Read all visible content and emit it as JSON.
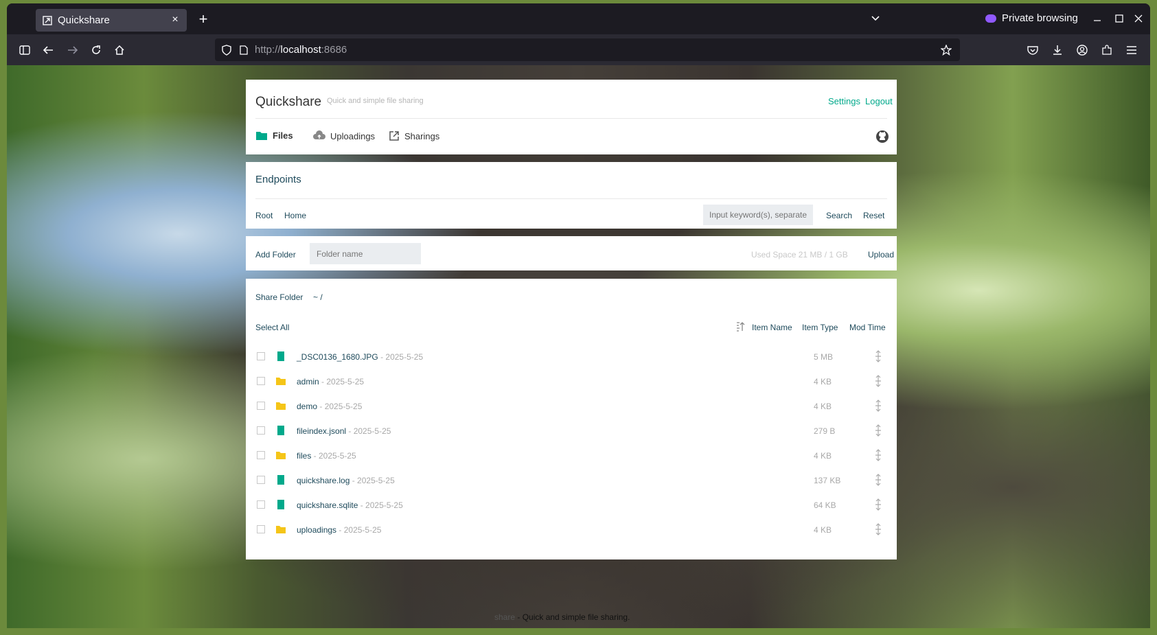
{
  "browser": {
    "tab_title": "Quickshare",
    "close_tab": "×",
    "new_tab": "+",
    "private_label": "Private browsing",
    "url_scheme": "http://",
    "url_host": "localhost",
    "url_port": ":8686"
  },
  "app": {
    "title": "Quickshare",
    "subtitle": "Quick and simple file sharing",
    "settings": "Settings",
    "logout": "Logout",
    "nav": {
      "files": "Files",
      "uploadings": "Uploadings",
      "sharings": "Sharings"
    }
  },
  "endpoints": {
    "title": "Endpoints",
    "root": "Root",
    "home": "Home",
    "search_placeholder": "Input keyword(s), separate",
    "search": "Search",
    "reset": "Reset"
  },
  "toolbar": {
    "add_folder": "Add Folder",
    "folder_placeholder": "Folder name",
    "used_space": "Used Space 21 MB / 1 GB",
    "upload": "Upload"
  },
  "listing": {
    "share_folder": "Share Folder",
    "path": "~ /",
    "select_all": "Select All",
    "col_name": "Item Name",
    "col_type": "Item Type",
    "col_time": "Mod Time",
    "items": [
      {
        "name": "_DSC0136_1680.JPG",
        "date": " - 2025-5-25",
        "size": "5 MB",
        "kind": "file"
      },
      {
        "name": "admin",
        "date": " - 2025-5-25",
        "size": "4 KB",
        "kind": "folder"
      },
      {
        "name": "demo",
        "date": " - 2025-5-25",
        "size": "4 KB",
        "kind": "folder"
      },
      {
        "name": "fileindex.jsonl",
        "date": " - 2025-5-25",
        "size": "279 B",
        "kind": "file"
      },
      {
        "name": "files",
        "date": " - 2025-5-25",
        "size": "4 KB",
        "kind": "folder"
      },
      {
        "name": "quickshare.log",
        "date": " - 2025-5-25",
        "size": "137 KB",
        "kind": "file"
      },
      {
        "name": "quickshare.sqlite",
        "date": " - 2025-5-25",
        "size": "64 KB",
        "kind": "file"
      },
      {
        "name": "uploadings",
        "date": " - 2025-5-25",
        "size": "4 KB",
        "kind": "folder"
      }
    ]
  },
  "footer": {
    "app_name_partial": "share",
    "tagline": " - Quick and simple file sharing."
  },
  "colors": {
    "accent": "#00a98b",
    "folder": "#f5c518",
    "link": "#1e4a5b"
  }
}
